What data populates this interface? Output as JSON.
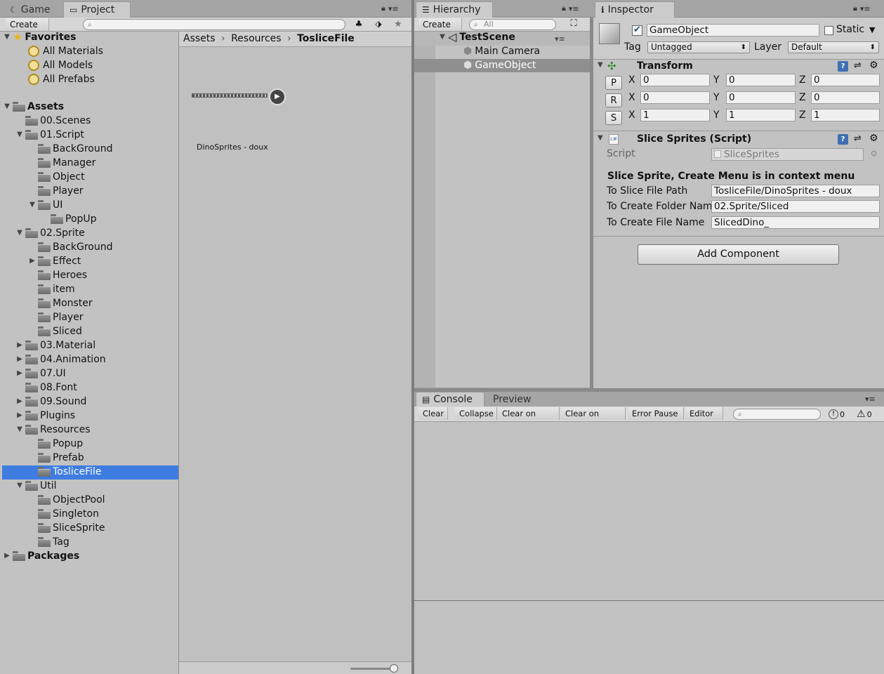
{
  "tabs": {
    "game": "Game",
    "project": "Project",
    "hierarchy": "Hierarchy",
    "inspector": "Inspector",
    "console": "Console",
    "preview": "Preview"
  },
  "project": {
    "create": "Create",
    "breadcrumb": [
      "Assets",
      "Resources",
      "ToslicеFile"
    ],
    "asset_label": "DinoSprites - doux",
    "favorites": {
      "title": "Favorites",
      "items": [
        "All Materials",
        "All Models",
        "All Prefabs"
      ]
    },
    "assets_title": "Assets",
    "packages_title": "Packages",
    "tree": [
      {
        "label": "00.Scenes"
      },
      {
        "label": "01.Script"
      },
      {
        "label": "BackGround"
      },
      {
        "label": "Manager"
      },
      {
        "label": "Object"
      },
      {
        "label": "Player"
      },
      {
        "label": "UI"
      },
      {
        "label": "PopUp"
      },
      {
        "label": "02.Sprite"
      },
      {
        "label": "BackGround"
      },
      {
        "label": "Effect"
      },
      {
        "label": "Heroes"
      },
      {
        "label": "item"
      },
      {
        "label": "Monster"
      },
      {
        "label": "Player"
      },
      {
        "label": "Sliced"
      },
      {
        "label": "03.Material"
      },
      {
        "label": "04.Animation"
      },
      {
        "label": "07.UI"
      },
      {
        "label": "08.Font"
      },
      {
        "label": "09.Sound"
      },
      {
        "label": "Plugins"
      },
      {
        "label": "Resources"
      },
      {
        "label": "Popup"
      },
      {
        "label": "Prefab"
      },
      {
        "label": "ToslicеFile"
      },
      {
        "label": "Util"
      },
      {
        "label": "ObjectPool"
      },
      {
        "label": "Singleton"
      },
      {
        "label": "SliceSprite"
      },
      {
        "label": "Tag"
      }
    ]
  },
  "hierarchy": {
    "create": "Create",
    "search_placeholder": "All",
    "scene": "TestScene",
    "items": [
      "Main Camera",
      "GameObject"
    ]
  },
  "inspector": {
    "name": "GameObject",
    "static_label": "Static",
    "tag_label": "Tag",
    "tag_value": "Untagged",
    "layer_label": "Layer",
    "layer_value": "Default",
    "transform": {
      "title": "Transform",
      "rows": [
        {
          "btn": "P",
          "x": "0",
          "y": "0",
          "z": "0"
        },
        {
          "btn": "R",
          "x": "0",
          "y": "0",
          "z": "0"
        },
        {
          "btn": "S",
          "x": "1",
          "y": "1",
          "z": "1"
        }
      ],
      "axis": [
        "X",
        "Y",
        "Z"
      ]
    },
    "script_component": {
      "title": "Slice Sprites (Script)",
      "script_label": "Script",
      "script_value": "SliceSprites",
      "note": "Slice Sprite, Create Menu is in context menu",
      "fields": [
        {
          "label": "To Slice File Path",
          "value": "ToslicеFile/DinoSprites - doux"
        },
        {
          "label": "To Create Folder Nam",
          "value": "02.Sprite/Sliced"
        },
        {
          "label": "To Create File Name",
          "value": "SlicedDino_"
        }
      ]
    },
    "add_component": "Add Component"
  },
  "console": {
    "buttons": [
      "Clear",
      "Collapse",
      "Clear on Play",
      "Clear on Build",
      "Error Pause",
      "Editor"
    ],
    "error_count": "0",
    "warning_count": "0"
  }
}
